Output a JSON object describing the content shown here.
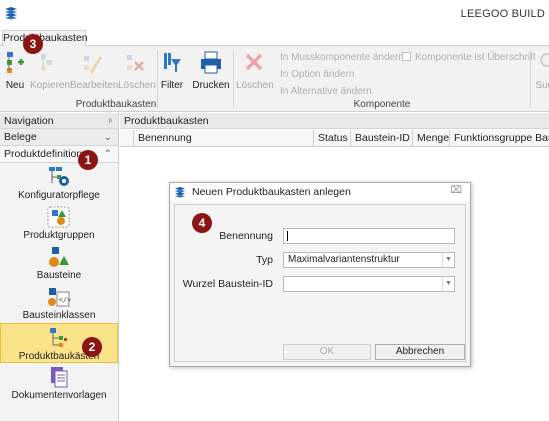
{
  "app": {
    "title": "LEEGOO BUILD"
  },
  "ribbon": {
    "tab": "Produktbaukasten",
    "buttons": {
      "neu": "Neu",
      "kopieren": "Kopieren",
      "bearbeiten": "Bearbeiten",
      "loeschen": "Löschen",
      "filter": "Filter",
      "drucken": "Drucken",
      "loeschen2": "Löschen",
      "suchen": "Suc"
    },
    "options": {
      "muss": "In Musskomponente ändern",
      "option": "In Option ändern",
      "alternative": "In Alternative ändern",
      "ueberschrift": "Komponente ist Überschrift"
    },
    "groups": {
      "produktbaukasten": "Produktbaukasten",
      "komponente": "Komponente"
    }
  },
  "nav": {
    "header": "Navigation",
    "pin": "ᵖ",
    "belege": "Belege",
    "produktdefinition": "Produktdefinition",
    "items": [
      {
        "label": "Konfiguratorpflege"
      },
      {
        "label": "Produktgruppen"
      },
      {
        "label": "Bausteine"
      },
      {
        "label": "Bausteinklassen"
      },
      {
        "label": "Produktbaukästen"
      },
      {
        "label": "Dokumentenvorlagen"
      }
    ]
  },
  "main": {
    "header": "Produktbaukasten",
    "columns": [
      "Benennung",
      "Status",
      "Baustein-ID",
      "Menge",
      "Funktionsgruppe Bauste"
    ]
  },
  "dialog": {
    "title": "Neuen Produktbaukasten anlegen",
    "close": "⌧",
    "fields": {
      "benennung": {
        "label": "Benennung",
        "value": ""
      },
      "typ": {
        "label": "Typ",
        "value": "Maximalvariantenstruktur"
      },
      "wurzel": {
        "label": "Wurzel Baustein-ID",
        "value": ""
      }
    },
    "ok": "OK",
    "cancel": "Abbrechen"
  },
  "badges": {
    "b1": "1",
    "b2": "2",
    "b3": "3",
    "b4": "4"
  },
  "colors": {
    "badge": "#8b1414",
    "active_nav": "#fbe38a",
    "accent_blue": "#1f5fa8"
  }
}
